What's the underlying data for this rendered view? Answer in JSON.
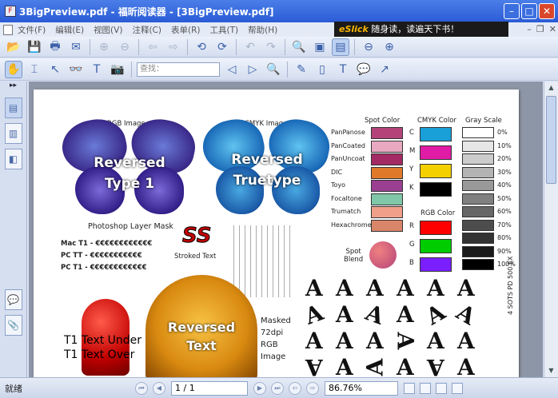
{
  "window": {
    "title": "3BigPreview.pdf - 福昕阅读器 - [3BigPreview.pdf]"
  },
  "menu": [
    "文件(F)",
    "编辑(E)",
    "视图(V)",
    "注释(C)",
    "表单(R)",
    "工具(T)",
    "帮助(H)"
  ],
  "banner": {
    "brand": "eSlick",
    "text": "随身读，读遍天下书！"
  },
  "toolbar": {
    "search_placeholder": "查找："
  },
  "status": {
    "text": "就绪",
    "page": "1 / 1",
    "zoom": "86.76%"
  },
  "page": {
    "rgb_image": "RGB Image",
    "cmyk_image": "CMYK Image",
    "reversed_type1": [
      "Reversed",
      "Type 1"
    ],
    "reversed_truetype": [
      "Reversed",
      "Truetype"
    ],
    "photoshop_mask": "Photoshop Layer Mask",
    "mac_t1": "Mac T1 - €€€€€€€€€€€€",
    "pc_tt": "PC TT - €€€€€€€€€€€",
    "pc_t1": "PC T1 - €€€€€€€€€€€€",
    "ss": "SS",
    "stroked": "Stroked Text",
    "spot_color": "Spot Color",
    "cmyk_color": "CMYK Color",
    "gray_scale": "Gray Scale",
    "rgb_color": "RGB Color",
    "spot_names": [
      "PanPanose",
      "PanCoated",
      "PanUncoat",
      "DIC",
      "Toyo",
      "Focaltone",
      "Trumatch",
      "Hexachrome"
    ],
    "cmyk_letters": [
      "C",
      "M",
      "Y",
      "K"
    ],
    "rgb_letters": [
      "R",
      "G",
      "B"
    ],
    "gray_pct": [
      "0%",
      "10%",
      "20%",
      "30%",
      "40%",
      "50%",
      "60%",
      "70%",
      "80%",
      "90%",
      "100%"
    ],
    "spot_blend": [
      "Spot",
      "Blend"
    ],
    "t1_under": "T1 Text Under",
    "t1_over": "T1 Text Over",
    "reversed_text": [
      "Reversed",
      "Text"
    ],
    "masked": [
      "Masked",
      "72dpi",
      "RGB",
      "Image"
    ],
    "footer_code": "4 SOTS PD 500 EX",
    "glyph_letter": "A"
  },
  "colors": {
    "spot": [
      "#b4437a",
      "#e8a8c0",
      "#a32a63",
      "#e07a2a",
      "#9a3f91",
      "#7fc7a8",
      "#f0a08a",
      "#d8856a"
    ],
    "cmyk": [
      "#1aa0d8",
      "#e01ba5",
      "#f5d000",
      "#000000"
    ],
    "rgb": [
      "#ff0000",
      "#00cc00",
      "#7a1fff"
    ],
    "gray": [
      "#ffffff",
      "#e6e6e6",
      "#cccccc",
      "#b3b3b3",
      "#999999",
      "#808080",
      "#666666",
      "#4d4d4d",
      "#333333",
      "#1a1a1a",
      "#000000"
    ]
  }
}
